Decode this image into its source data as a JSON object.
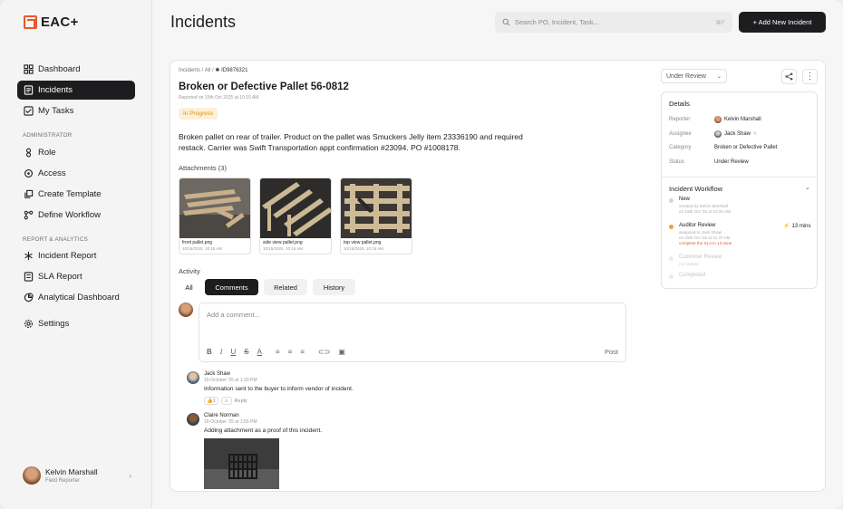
{
  "app": {
    "name": "EAC+",
    "brand_color": "#e8582a"
  },
  "sidebar": {
    "items": [
      {
        "label": "Dashboard",
        "icon": "grid-icon"
      },
      {
        "label": "Incidents",
        "icon": "document-icon",
        "active": true
      },
      {
        "label": "My Tasks",
        "icon": "checklist-icon"
      }
    ],
    "admin_section": "ADMINISTRATOR",
    "admin_items": [
      {
        "label": "Role",
        "icon": "role-icon"
      },
      {
        "label": "Access",
        "icon": "key-icon"
      },
      {
        "label": "Create Template",
        "icon": "template-icon"
      },
      {
        "label": "Define Workflow",
        "icon": "workflow-icon"
      }
    ],
    "report_section": "REPORT & ANALYTICS",
    "report_items": [
      {
        "label": "Incident Report",
        "icon": "asterisk-icon"
      },
      {
        "label": "SLA Report",
        "icon": "report-icon"
      },
      {
        "label": "Analytical Dashboard",
        "icon": "pie-chart-icon"
      }
    ],
    "settings": {
      "label": "Settings",
      "icon": "gear-icon"
    },
    "user": {
      "name": "Kelvin Marshall",
      "role": "Field Reporter"
    }
  },
  "header": {
    "title": "Incidents",
    "search_placeholder": "Search PO, Incident, Task...",
    "search_shortcut": "⌘F",
    "new_button": "+ Add New Incident"
  },
  "incident": {
    "breadcrumb": [
      "Incidents",
      "All",
      "ID9876321"
    ],
    "title": "Broken or Defective Pallet 56-0812",
    "reported": "Reported on 15th Oct 2025 at 10:15 AM",
    "status_badge": "In Progress",
    "description": "Broken pallet on rear of trailer. Product on the pallet was Smuckers Jelly item 23336190 and required restack. Carrier was Swift Transportation appt confirmation #23094. PO #1008178.",
    "attachments_title": "Attachments (3)",
    "attachments": [
      {
        "name": "front pallet.png",
        "date": "10/15/2025, 10:15 AM"
      },
      {
        "name": "side view pallet.png",
        "date": "10/15/2025, 10:15 AM"
      },
      {
        "name": "top view pallet.png",
        "date": "10/15/2025, 10:15 AM"
      }
    ]
  },
  "activity": {
    "title": "Activity",
    "tabs": [
      "All",
      "Comments",
      "Related",
      "History"
    ],
    "selected_tab": "Comments",
    "comment_placeholder": "Add a comment...",
    "post_label": "Post",
    "comments": [
      {
        "author": "Jack Shaw",
        "date": "16-October '25 at 1:33 PM",
        "text": "Information sent to the buyer to inform vendor of incident.",
        "reaction_count": "1",
        "reply": "Reply"
      },
      {
        "author": "Claire Norman",
        "date": "16-October '25 at 1:55 PM",
        "text": "Adding attachment as a proof of this incident."
      }
    ]
  },
  "details": {
    "status_dropdown": "Under Review",
    "title": "Details",
    "rows": [
      {
        "label": "Reporter",
        "value": "Kelvin Marshall"
      },
      {
        "label": "Assignee",
        "value": "Jack Shaw"
      },
      {
        "label": "Category",
        "value": "Broken or Defective Pallet"
      },
      {
        "label": "Status",
        "value": "Under Review"
      }
    ]
  },
  "workflow": {
    "title": "Incident Workflow",
    "steps": [
      {
        "name": "New",
        "sub1": "created by Kelvin Marshall",
        "sub2": "on 15th Oct '25 at 10:15 AM",
        "state": "done"
      },
      {
        "name": "Auditor Review",
        "sub1": "assigned to Jack Shaw",
        "sub2": "on 15th Oct '25 at 11:37 AM",
        "sub3": "complete the SLA in 13 mins",
        "sla": "13 mins",
        "state": "current"
      },
      {
        "name": "Customer Review",
        "sub1": "not started",
        "state": "pending"
      },
      {
        "name": "Completed",
        "state": "pending"
      }
    ],
    "colors": {
      "current": "#f0a030",
      "sla_warning": "#e8582a"
    }
  }
}
